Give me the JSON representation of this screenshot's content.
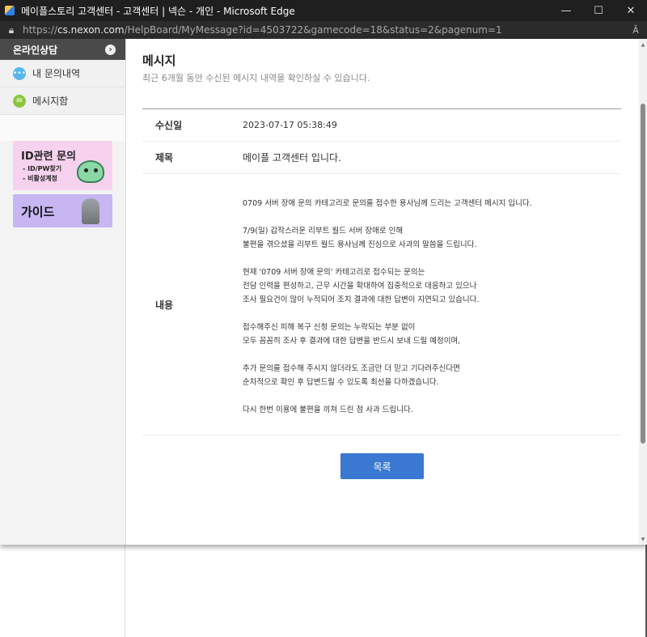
{
  "window": {
    "title": "메이플스토리 고객센터 - 고객센터 | 넥슨 - 개인 - Microsoft Edge",
    "minimize": "—",
    "maximize": "☐",
    "close": "✕"
  },
  "address": {
    "scheme": "https://",
    "host": "cs.nexon.com",
    "path": "/HelpBoard/MyMessage?id=4503722&gamecode=18&status=2&pagenum=1",
    "read_aloud": "Ă"
  },
  "sidebar": {
    "header": "온라인상담",
    "items": [
      {
        "label": "내 문의내역",
        "icon": "speech-bubble-icon"
      },
      {
        "label": "메시지함",
        "icon": "envelope-icon"
      }
    ],
    "banners": {
      "id_title": "ID관련 문의",
      "id_line1": "- ID/PW찾기",
      "id_line2": "- 비활성계정",
      "guide_title": "가이드"
    }
  },
  "main": {
    "title": "메시지",
    "description": "최근 6개월 동안 수신된 메시지 내역을 확인하실 수 있습니다.",
    "date_label": "수신일",
    "date_value": "2023-07-17 05:38:49",
    "subject_label": "제목",
    "subject_value": "메이플 고객센터 입니다.",
    "content_label": "내용",
    "content_paragraphs": [
      [
        "0709 서버 장애 문의 카테고리로 문의를 접수한 용사님께 드리는 고객센터 메시지 입니다."
      ],
      [
        "7/9(일) 갑작스러운 리부트 월드 서버 장애로 인해",
        "불편을 겪으셨을 리부트 월드 용사님께 진심으로 사과의 말씀을 드립니다."
      ],
      [
        "현재 '0709 서버 장애 문의' 카테고리로 접수되는 문의는",
        "전담 인력을 편성하고, 근무 시간을 확대하여 집중적으로 대응하고 있으나",
        "조사 필요건이 많이 누적되어 조치 결과에 대한 답변이 지연되고 있습니다."
      ],
      [
        "접수해주신 피해 복구 신청 문의는 누락되는 부분 없이",
        "모두 꼼꼼히 조사 후 결과에 대한 답변을 반드시 보내 드릴 예정이며,"
      ],
      [
        "추가 문의를 접수해 주시지 않더라도 조금만 더 믿고 기다려주신다면",
        "순차적으로 확인 후 답변드릴 수 있도록 최선을 다하겠습니다."
      ],
      [
        "다시 한번 이용에 불편을 끼쳐 드린 점 사과 드립니다."
      ]
    ],
    "list_button": "목록"
  },
  "colors": {
    "titlebar": "#1f1f1f",
    "sidebar_header": "#4a4a4a",
    "button": "#3a78d1"
  }
}
